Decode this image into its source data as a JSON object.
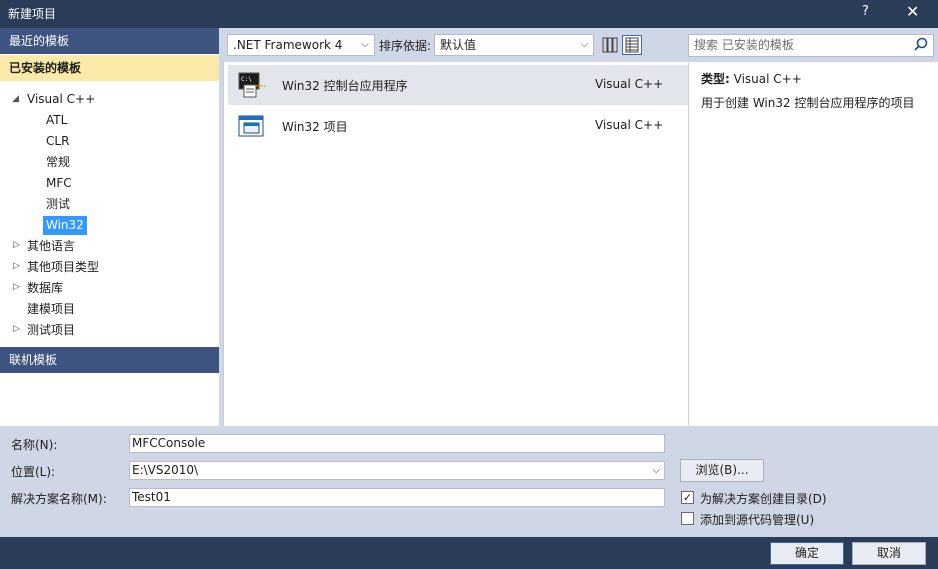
{
  "window": {
    "title": "新建项目",
    "help_label": "?",
    "close_label": "✕"
  },
  "sidebar": {
    "recent_label": "最近的模板",
    "installed_label": "已安装的模板",
    "online_label": "联机模板",
    "tree": [
      {
        "label": "Visual C++",
        "expanded": true
      },
      {
        "label": "ATL"
      },
      {
        "label": "CLR"
      },
      {
        "label": "常规"
      },
      {
        "label": "MFC"
      },
      {
        "label": "测试"
      },
      {
        "label": "Win32",
        "selected": true
      },
      {
        "label": "其他语言",
        "collapsed": true
      },
      {
        "label": "其他项目类型",
        "collapsed": true
      },
      {
        "label": "数据库",
        "collapsed": true
      },
      {
        "label": "建模项目"
      },
      {
        "label": "测试项目",
        "collapsed": true
      }
    ]
  },
  "toolbar": {
    "framework_value": ".NET Framework 4",
    "sort_label": "排序依据:",
    "sort_value": "默认值",
    "search_placeholder": "搜索 已安装的模板"
  },
  "templates": [
    {
      "name": "Win32 控制台应用程序",
      "language": "Visual C++",
      "selected": true,
      "icon": "console-app-icon"
    },
    {
      "name": "Win32 项目",
      "language": "Visual C++",
      "selected": false,
      "icon": "win32-project-icon"
    }
  ],
  "details": {
    "type_label": "类型:",
    "type_value": "Visual C++",
    "description": "用于创建 Win32 控制台应用程序的项目"
  },
  "form": {
    "name_label": "名称(N):",
    "name_value": "MFCConsole",
    "location_label": "位置(L):",
    "location_value": "E:\\VS2010\\",
    "solution_label": "解决方案名称(M):",
    "solution_value": "Test01",
    "browse_label": "浏览(B)...",
    "create_dir_label": "为解决方案创建目录(D)",
    "create_dir_checked": true,
    "add_source_label": "添加到源代码管理(U)",
    "add_source_checked": false
  },
  "buttons": {
    "ok_label": "确定",
    "cancel_label": "取消"
  },
  "colors": {
    "titlebar": "#2b3c59",
    "section_header": "#3d5480",
    "installed_highlight": "#fceaa8",
    "selection": "#3399ff"
  }
}
